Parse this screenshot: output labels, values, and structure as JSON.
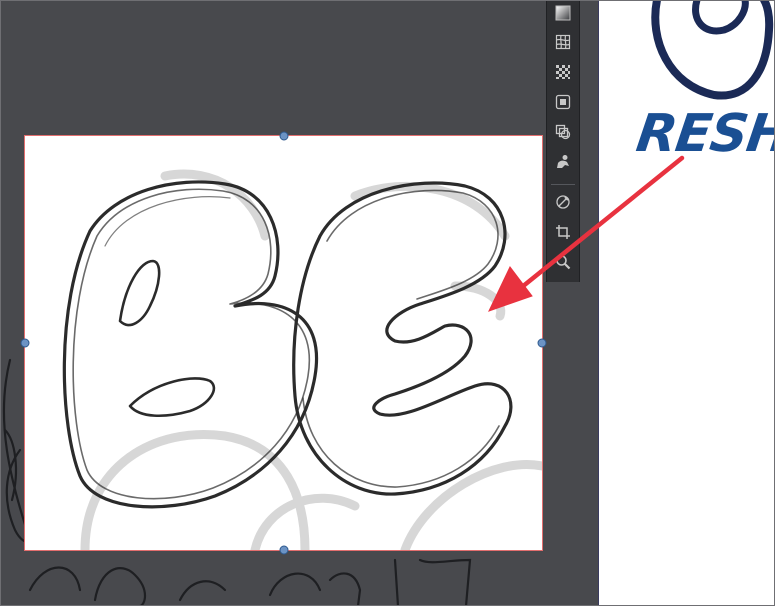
{
  "canvas": {
    "background": "#48494d",
    "artboard_background": "#ffffff"
  },
  "artboard": {
    "logo_text": "RESHA",
    "logo_color": "#1a4f93"
  },
  "placed_image": {
    "sketch_text": "BE",
    "frame_color": "#e36e6e",
    "handle_color": "#6c93c4"
  },
  "toolbar": {
    "tools": [
      {
        "name": "gradient-tool",
        "icon": "gradient-icon"
      },
      {
        "name": "mesh-tool",
        "icon": "mesh-grid-icon"
      },
      {
        "name": "chart-tool",
        "icon": "checker-grid-icon"
      },
      {
        "name": "artboard-tool",
        "icon": "square-icon"
      },
      {
        "name": "shape-builder-tool",
        "icon": "overlap-shapes-icon"
      },
      {
        "name": "puppet-warp-tool",
        "icon": "puppet-icon"
      },
      {
        "name": "live-paint-tool",
        "icon": "paint-bucket-icon"
      },
      {
        "name": "crop-tool",
        "icon": "crop-icon"
      },
      {
        "name": "zoom-tool",
        "icon": "magnifier-icon"
      }
    ]
  },
  "annotation": {
    "arrow_color": "#e8323f"
  }
}
